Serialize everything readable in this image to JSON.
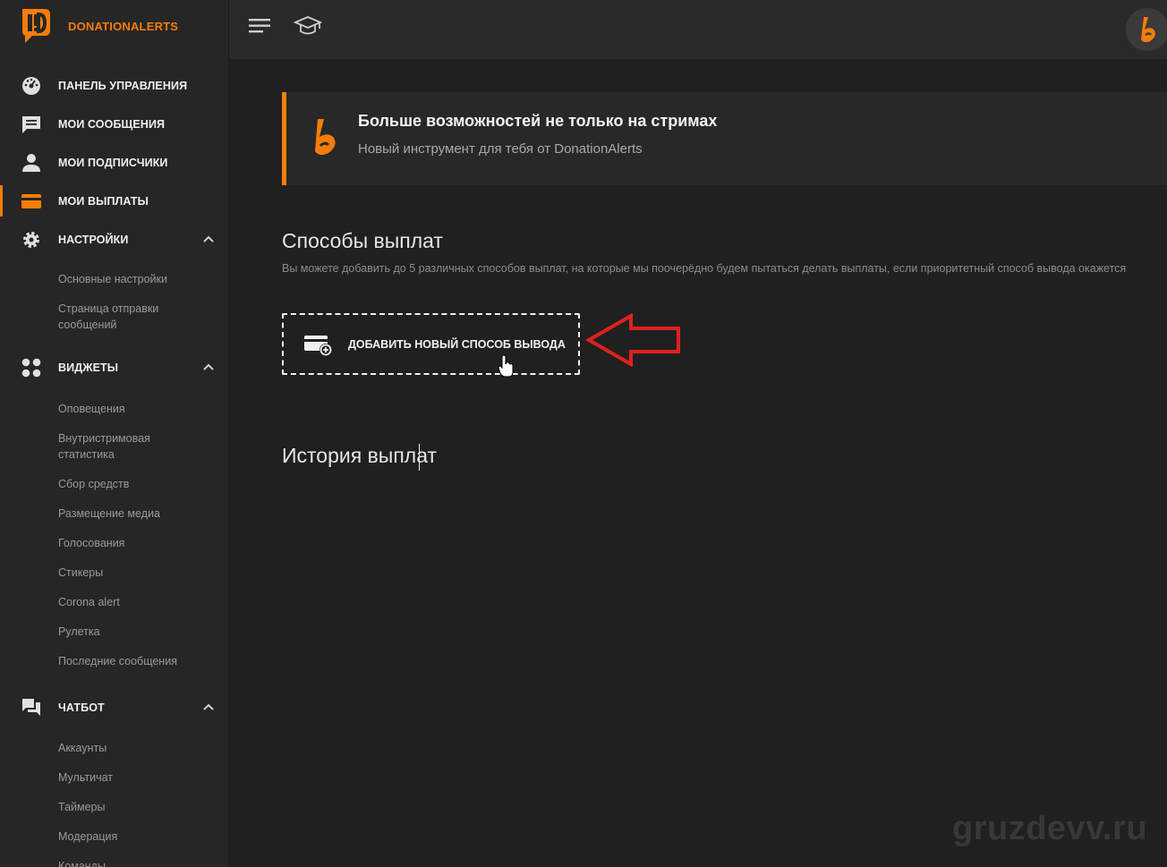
{
  "brand": {
    "name": "DONATIONALERTS",
    "accent": "#f57d07"
  },
  "sidebar": {
    "items": [
      {
        "label": "ПАНЕЛЬ УПРАВЛЕНИЯ",
        "icon": "dashboard-icon"
      },
      {
        "label": "МОИ СООБЩЕНИЯ",
        "icon": "message-icon"
      },
      {
        "label": "МОИ ПОДПИСЧИКИ",
        "icon": "user-icon"
      },
      {
        "label": "МОИ ВЫПЛАТЫ",
        "icon": "card-icon",
        "active": true
      },
      {
        "label": "НАСТРОЙКИ",
        "icon": "gear-icon",
        "expanded": true
      },
      {
        "label": "ВИДЖЕТЫ",
        "icon": "widgets-icon",
        "expanded": true
      },
      {
        "label": "ЧАТБОТ",
        "icon": "chat-icon",
        "expanded": true
      }
    ],
    "settings_sub": [
      "Основные настройки",
      "Страница отправки сообщений"
    ],
    "widgets_sub": [
      "Оповещения",
      "Внутристримовая статистика",
      "Сбор средств",
      "Размещение медиа",
      "Голосования",
      "Стикеры",
      "Corona alert",
      "Рулетка",
      "Последние сообщения"
    ],
    "chatbot_sub": [
      "Аккаунты",
      "Мультичат",
      "Таймеры",
      "Модерация",
      "Команды"
    ]
  },
  "topbar": {
    "menu_icon": "hamburger-icon",
    "edu_icon": "graduation-cap-icon"
  },
  "banner": {
    "title": "Больше возможностей не только на стримах",
    "subtitle": "Новый инструмент для тебя от DonationAlerts"
  },
  "payout_methods": {
    "title": "Способы выплат",
    "description": "Вы можете добавить до 5 различных способов выплат, на которые мы поочерёдно будем пытаться делать выплаты, если приоритетный способ вывода окажется",
    "add_button": "ДОБАВИТЬ НОВЫЙ СПОСОБ ВЫВОДА"
  },
  "history": {
    "title": "История выплат"
  },
  "annotation": {
    "arrow_color": "#e02020"
  },
  "watermark": "gruzdevv.ru"
}
